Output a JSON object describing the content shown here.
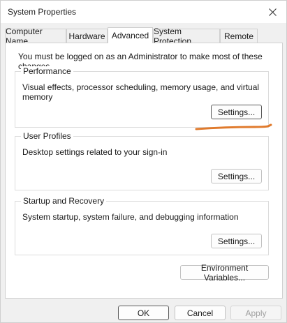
{
  "window": {
    "title": "System Properties",
    "close_icon": "close-icon"
  },
  "tabs": [
    {
      "label": "Computer Name",
      "active": false
    },
    {
      "label": "Hardware",
      "active": false
    },
    {
      "label": "Advanced",
      "active": true
    },
    {
      "label": "System Protection",
      "active": false
    },
    {
      "label": "Remote",
      "active": false
    }
  ],
  "advanced": {
    "note": "You must be logged on as an Administrator to make most of these changes.",
    "performance": {
      "legend": "Performance",
      "description": "Visual effects, processor scheduling, memory usage, and virtual memory",
      "button": "Settings..."
    },
    "user_profiles": {
      "legend": "User Profiles",
      "description": "Desktop settings related to your sign-in",
      "button": "Settings..."
    },
    "startup_recovery": {
      "legend": "Startup and Recovery",
      "description": "System startup, system failure, and debugging information",
      "button": "Settings..."
    },
    "environment_button": "Environment Variables..."
  },
  "footer": {
    "ok": "OK",
    "cancel": "Cancel",
    "apply": "Apply"
  },
  "annotation": {
    "color": "#e07a2c"
  }
}
